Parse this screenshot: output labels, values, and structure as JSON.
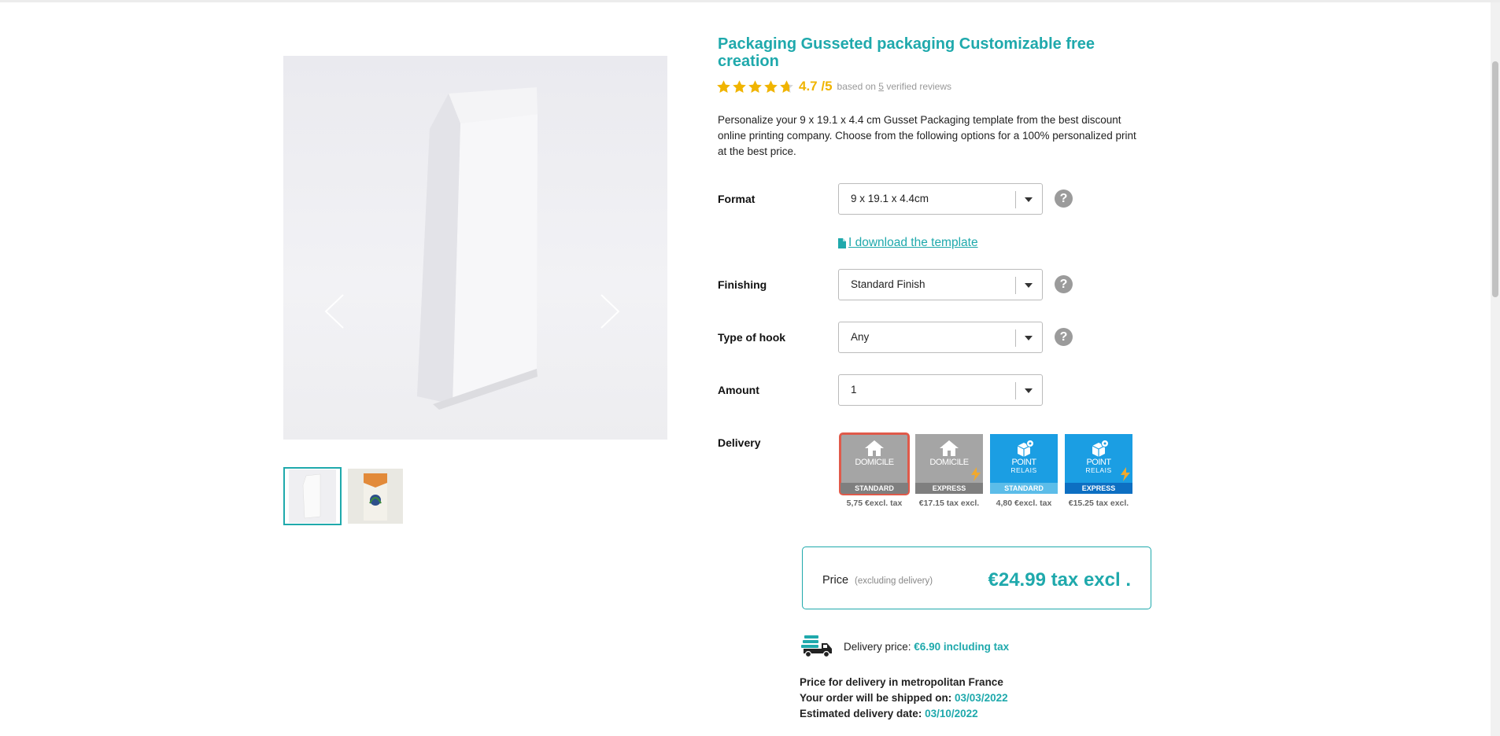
{
  "product": {
    "title": "Packaging Gusseted packaging Customizable free creation",
    "rating_score": "4.7 /5",
    "rating_value": 4.7,
    "rating_prefix": "based on",
    "rating_count": "5",
    "rating_suffix": "verified reviews",
    "description": "Personalize your 9 x 19.1 x 4.4 cm Gusset Packaging template from the best discount online printing company. Choose from the following options for a 100% personalized print at the best price."
  },
  "gallery": {
    "thumbnail_count": 2
  },
  "options": {
    "format": {
      "label": "Format",
      "value": "9 x 19.1 x 4.4cm"
    },
    "download_link": "I download the template",
    "finishing": {
      "label": "Finishing",
      "value": "Standard Finish"
    },
    "hook": {
      "label": "Type of hook",
      "value": "Any"
    },
    "amount": {
      "label": "Amount",
      "value": "1"
    },
    "delivery_label": "Delivery"
  },
  "delivery_options": [
    {
      "line1": "DOMICILE",
      "line2": "",
      "band": "STANDARD",
      "cost": "5,75 €excl. tax",
      "selected": true
    },
    {
      "line1": "DOMICILE",
      "line2": "",
      "band": "EXPRESS",
      "cost": "€17.15 tax excl.",
      "selected": false
    },
    {
      "line1": "POINT",
      "line2": "RELAIS",
      "band": "STANDARD",
      "cost": "4,80 €excl. tax",
      "selected": false
    },
    {
      "line1": "POINT",
      "line2": "RELAIS",
      "band": "EXPRESS",
      "cost": "€15.25 tax excl.",
      "selected": false
    }
  ],
  "price": {
    "label": "Price",
    "sub": "(excluding delivery)",
    "amount": "€24.99 tax excl ."
  },
  "shipping": {
    "label": "Delivery price:",
    "value": "€6.90 including tax"
  },
  "info": {
    "line1": "Price for delivery in metropolitan France",
    "ship_label": "Your order will be shipped on:",
    "ship_date": "03/03/2022",
    "est_label": "Estimated delivery date:",
    "est_date": "03/10/2022"
  },
  "colors": {
    "accent": "#1fa9ac",
    "star": "#f0b400",
    "selected_border": "#e05a4a",
    "blue": "#1b9ee3",
    "gray": "#a5a5a5"
  }
}
